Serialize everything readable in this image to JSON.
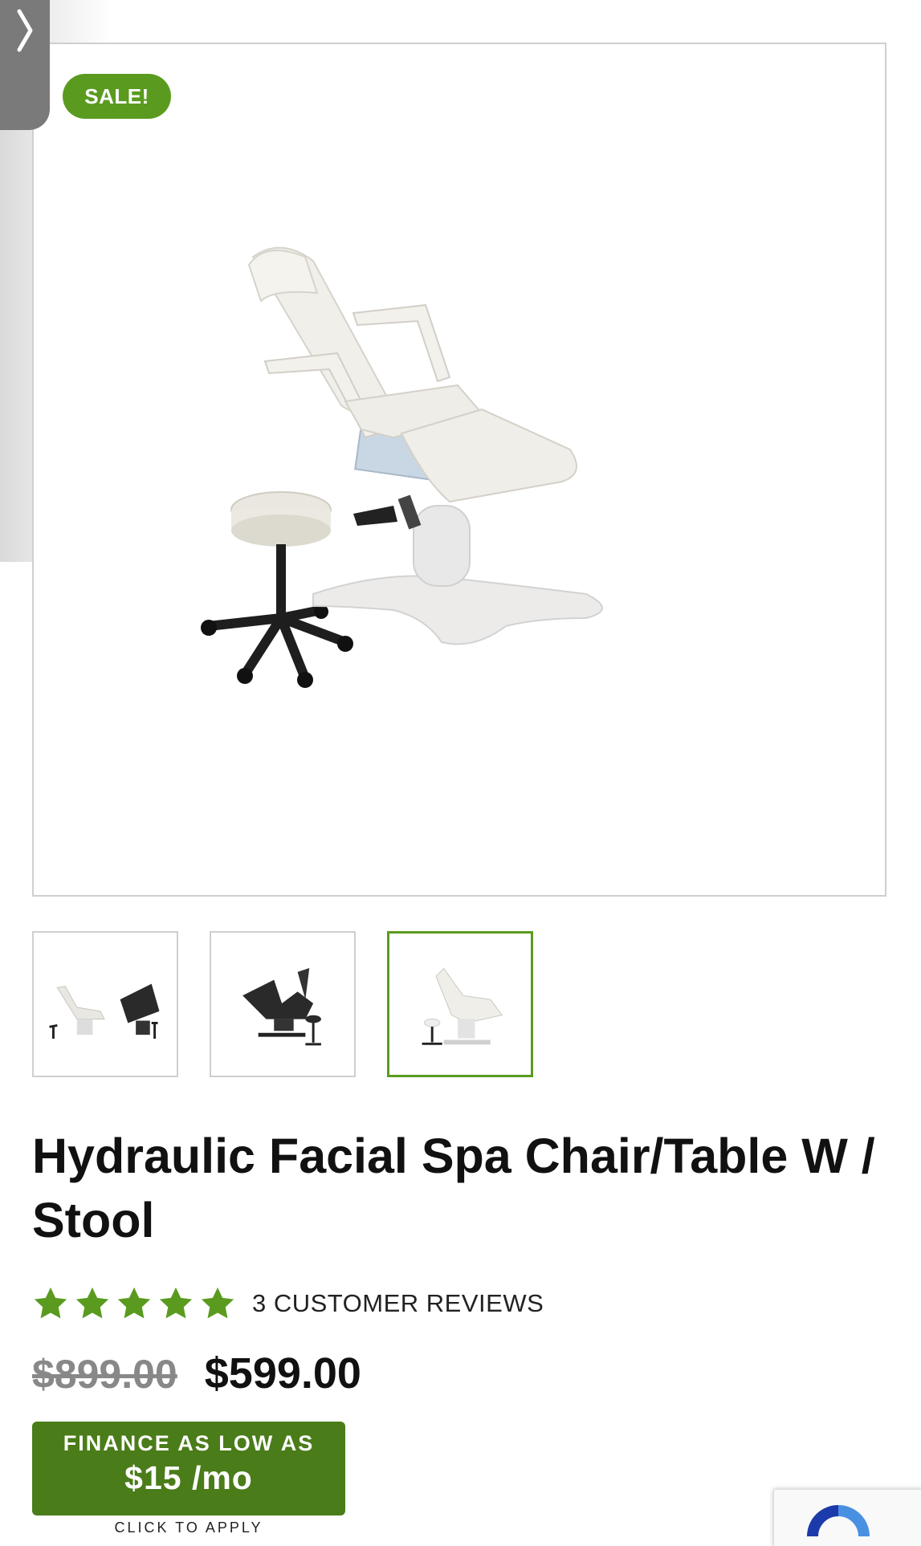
{
  "drawer": {
    "icon": "chevron-right-icon"
  },
  "badge": {
    "label": "SALE!"
  },
  "gallery": {
    "main_image": "spa-chair-with-stool-image",
    "thumbnails": [
      {
        "icon": "white-and-black-chairs-thumbnail",
        "active": false
      },
      {
        "icon": "black-chair-thumbnail",
        "active": false
      },
      {
        "icon": "white-chair-thumbnail",
        "active": true
      }
    ]
  },
  "product": {
    "title": "Hydraulic Facial Spa Chair/Table W / Stool",
    "rating": 5,
    "reviews_label": "3 CUSTOMER REVIEWS",
    "old_price": "$899.00",
    "price": "$599.00"
  },
  "finance": {
    "top_label": "FINANCE AS LOW AS",
    "amount": "$15 /mo",
    "cta": "CLICK TO APPLY"
  },
  "colors": {
    "accent": "#5a9b1f",
    "finance": "#4a7c19",
    "star": "#5a9b1f"
  }
}
